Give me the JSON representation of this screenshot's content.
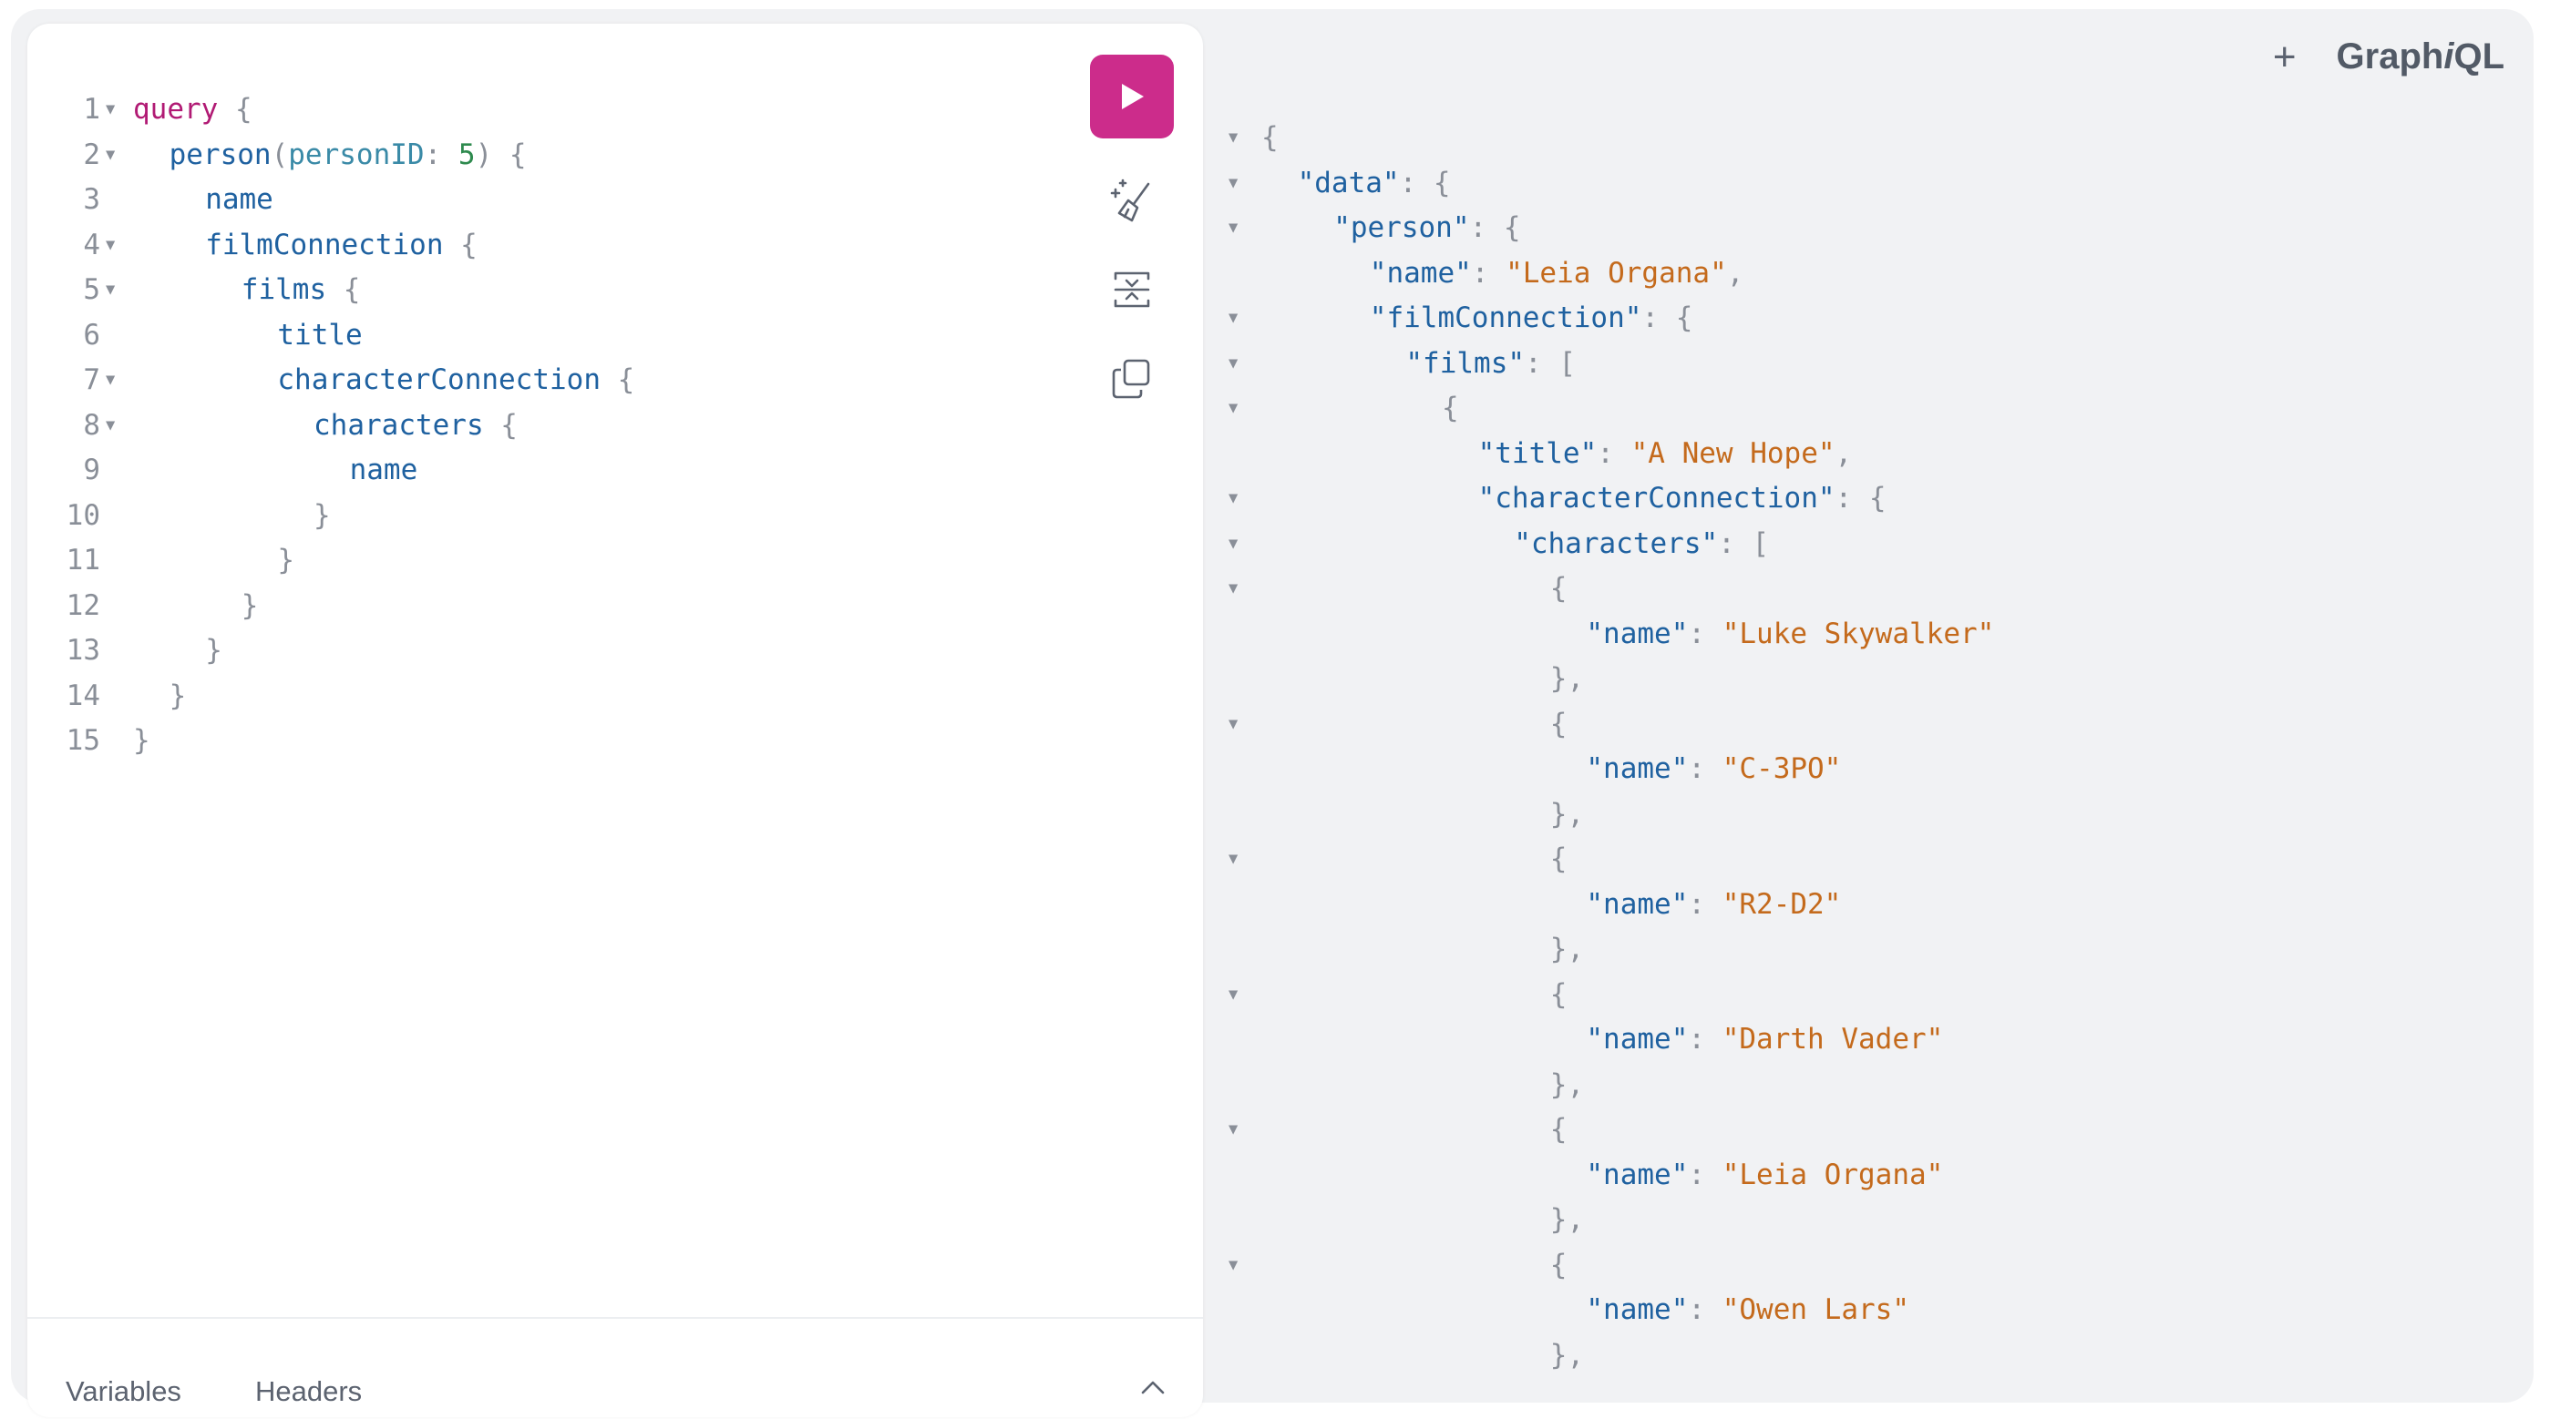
{
  "app": {
    "title": "GraphiQL",
    "title_prefix": "Graph",
    "title_italic": "i",
    "title_suffix": "QL"
  },
  "toolbar": {
    "add_tab_label": "+",
    "run": "run-button",
    "prettify": "prettify-icon",
    "merge": "merge-fragments-icon",
    "copy": "copy-icon"
  },
  "editor": {
    "lines": [
      {
        "n": "1",
        "fold": true,
        "indent": 0,
        "tokens": [
          {
            "t": "query",
            "c": "kw"
          },
          {
            "t": " {",
            "c": "pu"
          }
        ]
      },
      {
        "n": "2",
        "fold": true,
        "indent": 1,
        "tokens": [
          {
            "t": "person",
            "c": "fld"
          },
          {
            "t": "(",
            "c": "pu"
          },
          {
            "t": "personID",
            "c": "arg"
          },
          {
            "t": ": ",
            "c": "pu"
          },
          {
            "t": "5",
            "c": "num"
          },
          {
            "t": ") {",
            "c": "pu"
          }
        ]
      },
      {
        "n": "3",
        "fold": false,
        "indent": 2,
        "tokens": [
          {
            "t": "name",
            "c": "fld"
          }
        ]
      },
      {
        "n": "4",
        "fold": true,
        "indent": 2,
        "tokens": [
          {
            "t": "filmConnection",
            "c": "fld"
          },
          {
            "t": " {",
            "c": "pu"
          }
        ]
      },
      {
        "n": "5",
        "fold": true,
        "indent": 3,
        "tokens": [
          {
            "t": "films",
            "c": "fld"
          },
          {
            "t": " {",
            "c": "pu"
          }
        ]
      },
      {
        "n": "6",
        "fold": false,
        "indent": 4,
        "tokens": [
          {
            "t": "title",
            "c": "fld"
          }
        ]
      },
      {
        "n": "7",
        "fold": true,
        "indent": 4,
        "tokens": [
          {
            "t": "characterConnection",
            "c": "fld"
          },
          {
            "t": " {",
            "c": "pu"
          }
        ]
      },
      {
        "n": "8",
        "fold": true,
        "indent": 5,
        "tokens": [
          {
            "t": "characters",
            "c": "fld"
          },
          {
            "t": " {",
            "c": "pu"
          }
        ]
      },
      {
        "n": "9",
        "fold": false,
        "indent": 6,
        "tokens": [
          {
            "t": "name",
            "c": "fld"
          }
        ]
      },
      {
        "n": "10",
        "fold": false,
        "indent": 5,
        "tokens": [
          {
            "t": "}",
            "c": "pu"
          }
        ]
      },
      {
        "n": "11",
        "fold": false,
        "indent": 4,
        "tokens": [
          {
            "t": "}",
            "c": "pu"
          }
        ]
      },
      {
        "n": "12",
        "fold": false,
        "indent": 3,
        "tokens": [
          {
            "t": "}",
            "c": "pu"
          }
        ]
      },
      {
        "n": "13",
        "fold": false,
        "indent": 2,
        "tokens": [
          {
            "t": "}",
            "c": "pu"
          }
        ]
      },
      {
        "n": "14",
        "fold": false,
        "indent": 1,
        "tokens": [
          {
            "t": "}",
            "c": "pu"
          }
        ]
      },
      {
        "n": "15",
        "fold": false,
        "indent": 0,
        "tokens": [
          {
            "t": "}",
            "c": "pu"
          }
        ]
      }
    ]
  },
  "bottom": {
    "variables_tab": "Variables",
    "headers_tab": "Headers"
  },
  "result": {
    "lines": [
      {
        "fold": true,
        "indent": 0,
        "tokens": [
          {
            "t": "{",
            "c": "pu"
          }
        ]
      },
      {
        "fold": true,
        "indent": 1,
        "tokens": [
          {
            "t": "\"data\"",
            "c": "key"
          },
          {
            "t": ": {",
            "c": "pu"
          }
        ]
      },
      {
        "fold": true,
        "indent": 2,
        "tokens": [
          {
            "t": "\"person\"",
            "c": "key"
          },
          {
            "t": ": {",
            "c": "pu"
          }
        ]
      },
      {
        "fold": false,
        "indent": 3,
        "tokens": [
          {
            "t": "\"name\"",
            "c": "key"
          },
          {
            "t": ": ",
            "c": "pu"
          },
          {
            "t": "\"Leia Organa\"",
            "c": "str"
          },
          {
            "t": ",",
            "c": "pu"
          }
        ]
      },
      {
        "fold": true,
        "indent": 3,
        "tokens": [
          {
            "t": "\"filmConnection\"",
            "c": "key"
          },
          {
            "t": ": {",
            "c": "pu"
          }
        ]
      },
      {
        "fold": true,
        "indent": 4,
        "tokens": [
          {
            "t": "\"films\"",
            "c": "key"
          },
          {
            "t": ": [",
            "c": "pu"
          }
        ]
      },
      {
        "fold": true,
        "indent": 5,
        "tokens": [
          {
            "t": "{",
            "c": "pu"
          }
        ]
      },
      {
        "fold": false,
        "indent": 6,
        "tokens": [
          {
            "t": "\"title\"",
            "c": "key"
          },
          {
            "t": ": ",
            "c": "pu"
          },
          {
            "t": "\"A New Hope\"",
            "c": "str"
          },
          {
            "t": ",",
            "c": "pu"
          }
        ]
      },
      {
        "fold": true,
        "indent": 6,
        "tokens": [
          {
            "t": "\"characterConnection\"",
            "c": "key"
          },
          {
            "t": ": {",
            "c": "pu"
          }
        ]
      },
      {
        "fold": true,
        "indent": 7,
        "tokens": [
          {
            "t": "\"characters\"",
            "c": "key"
          },
          {
            "t": ": [",
            "c": "pu"
          }
        ]
      },
      {
        "fold": true,
        "indent": 8,
        "tokens": [
          {
            "t": "{",
            "c": "pu"
          }
        ]
      },
      {
        "fold": false,
        "indent": 9,
        "tokens": [
          {
            "t": "\"name\"",
            "c": "key"
          },
          {
            "t": ": ",
            "c": "pu"
          },
          {
            "t": "\"Luke Skywalker\"",
            "c": "str"
          }
        ]
      },
      {
        "fold": false,
        "indent": 8,
        "tokens": [
          {
            "t": "},",
            "c": "pu"
          }
        ]
      },
      {
        "fold": true,
        "indent": 8,
        "tokens": [
          {
            "t": "{",
            "c": "pu"
          }
        ]
      },
      {
        "fold": false,
        "indent": 9,
        "tokens": [
          {
            "t": "\"name\"",
            "c": "key"
          },
          {
            "t": ": ",
            "c": "pu"
          },
          {
            "t": "\"C-3PO\"",
            "c": "str"
          }
        ]
      },
      {
        "fold": false,
        "indent": 8,
        "tokens": [
          {
            "t": "},",
            "c": "pu"
          }
        ]
      },
      {
        "fold": true,
        "indent": 8,
        "tokens": [
          {
            "t": "{",
            "c": "pu"
          }
        ]
      },
      {
        "fold": false,
        "indent": 9,
        "tokens": [
          {
            "t": "\"name\"",
            "c": "key"
          },
          {
            "t": ": ",
            "c": "pu"
          },
          {
            "t": "\"R2-D2\"",
            "c": "str"
          }
        ]
      },
      {
        "fold": false,
        "indent": 8,
        "tokens": [
          {
            "t": "},",
            "c": "pu"
          }
        ]
      },
      {
        "fold": true,
        "indent": 8,
        "tokens": [
          {
            "t": "{",
            "c": "pu"
          }
        ]
      },
      {
        "fold": false,
        "indent": 9,
        "tokens": [
          {
            "t": "\"name\"",
            "c": "key"
          },
          {
            "t": ": ",
            "c": "pu"
          },
          {
            "t": "\"Darth Vader\"",
            "c": "str"
          }
        ]
      },
      {
        "fold": false,
        "indent": 8,
        "tokens": [
          {
            "t": "},",
            "c": "pu"
          }
        ]
      },
      {
        "fold": true,
        "indent": 8,
        "tokens": [
          {
            "t": "{",
            "c": "pu"
          }
        ]
      },
      {
        "fold": false,
        "indent": 9,
        "tokens": [
          {
            "t": "\"name\"",
            "c": "key"
          },
          {
            "t": ": ",
            "c": "pu"
          },
          {
            "t": "\"Leia Organa\"",
            "c": "str"
          }
        ]
      },
      {
        "fold": false,
        "indent": 8,
        "tokens": [
          {
            "t": "},",
            "c": "pu"
          }
        ]
      },
      {
        "fold": true,
        "indent": 8,
        "tokens": [
          {
            "t": "{",
            "c": "pu"
          }
        ]
      },
      {
        "fold": false,
        "indent": 9,
        "tokens": [
          {
            "t": "\"name\"",
            "c": "key"
          },
          {
            "t": ": ",
            "c": "pu"
          },
          {
            "t": "\"Owen Lars\"",
            "c": "str"
          }
        ]
      },
      {
        "fold": false,
        "indent": 8,
        "tokens": [
          {
            "t": "},",
            "c": "pu"
          }
        ]
      }
    ]
  },
  "colors": {
    "run_button": "#cc2c8b",
    "keyword": "#b11a74",
    "field": "#1f61a0",
    "argument": "#3a8aa7",
    "number": "#2e8a4e",
    "string": "#c46a1c",
    "punctuation": "#8a8f98",
    "background": "#f1f2f4"
  }
}
